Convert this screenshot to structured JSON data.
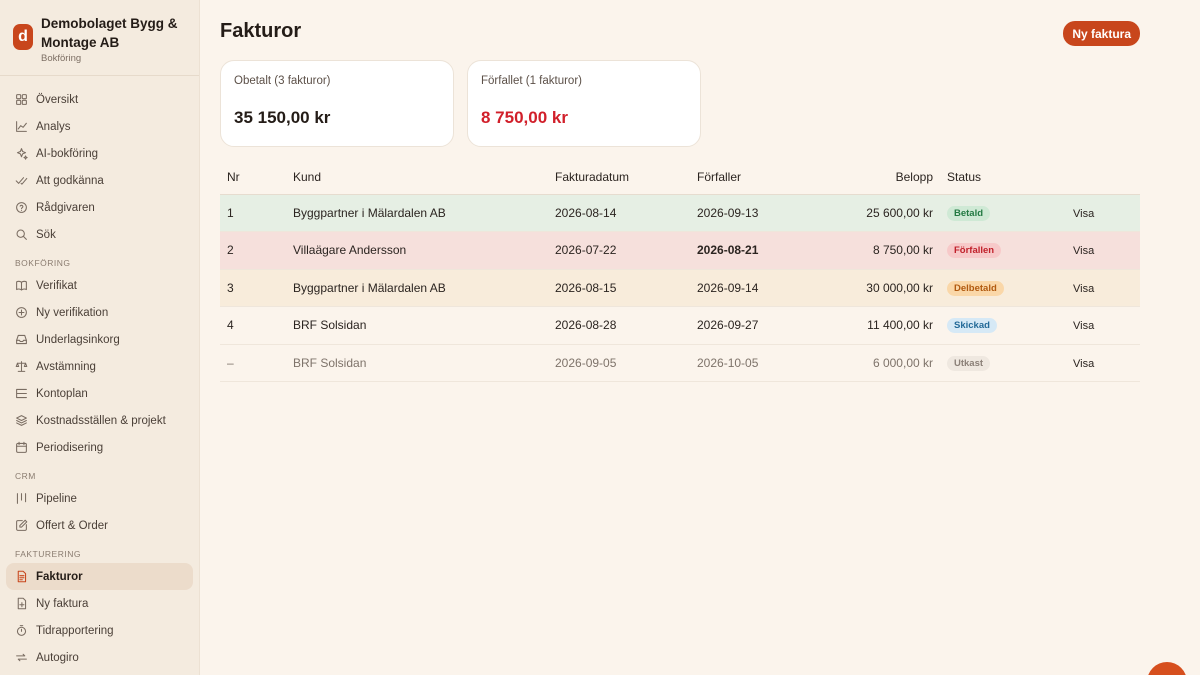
{
  "company": {
    "logo_letter": "d",
    "name": "Demobolaget Bygg & Montage AB",
    "subtitle": "Bokföring"
  },
  "sidebar": {
    "top_items": [
      {
        "label": "Översikt",
        "icon": "grid-icon"
      },
      {
        "label": "Analys",
        "icon": "chart-line-icon"
      },
      {
        "label": "AI-bokföring",
        "icon": "sparkle-icon"
      },
      {
        "label": "Att godkänna",
        "icon": "double-check-icon"
      },
      {
        "label": "Rådgivaren",
        "icon": "help-circle-icon"
      },
      {
        "label": "Sök",
        "icon": "search-icon"
      }
    ],
    "sections": [
      {
        "title": "BOKFÖRING",
        "items": [
          {
            "label": "Verifikat",
            "icon": "book-icon"
          },
          {
            "label": "Ny verifikation",
            "icon": "plus-circle-icon"
          },
          {
            "label": "Underlagsinkorg",
            "icon": "inbox-icon"
          },
          {
            "label": "Avstämning",
            "icon": "scale-icon"
          },
          {
            "label": "Kontoplan",
            "icon": "list-tree-icon"
          },
          {
            "label": "Kostnadsställen & projekt",
            "icon": "layers-icon"
          },
          {
            "label": "Periodisering",
            "icon": "calendar-icon"
          }
        ]
      },
      {
        "title": "CRM",
        "items": [
          {
            "label": "Pipeline",
            "icon": "pipeline-icon"
          },
          {
            "label": "Offert & Order",
            "icon": "edit-document-icon"
          }
        ]
      },
      {
        "title": "FAKTURERING",
        "items": [
          {
            "label": "Fakturor",
            "icon": "invoice-icon",
            "active": true
          },
          {
            "label": "Ny faktura",
            "icon": "file-plus-icon"
          },
          {
            "label": "Tidrapportering",
            "icon": "timer-icon"
          },
          {
            "label": "Autogiro",
            "icon": "repeat-icon"
          }
        ]
      }
    ]
  },
  "header": {
    "title": "Fakturor",
    "new_button": "Ny faktura"
  },
  "cards": [
    {
      "label": "Obetalt (3 fakturor)",
      "value": "35 150,00 kr",
      "highlight": false
    },
    {
      "label": "Förfallet (1 fakturor)",
      "value": "8 750,00 kr",
      "highlight": true
    }
  ],
  "table": {
    "columns": {
      "nr": "Nr",
      "customer": "Kund",
      "invoice_date": "Fakturadatum",
      "due_date": "Förfaller",
      "amount": "Belopp",
      "status": "Status"
    },
    "rows": [
      {
        "nr": "1",
        "customer": "Byggpartner i Mälardalen AB",
        "invoice_date": "2026-08-14",
        "due_date": "2026-09-13",
        "amount": "25 600,00 kr",
        "status": "Betald",
        "status_kind": "paid",
        "action": "Visa"
      },
      {
        "nr": "2",
        "customer": "Villaägare Andersson",
        "invoice_date": "2026-07-22",
        "due_date": "2026-08-21",
        "amount": "8 750,00 kr",
        "status": "Förfallen",
        "status_kind": "overdue",
        "action": "Visa"
      },
      {
        "nr": "3",
        "customer": "Byggpartner i Mälardalen AB",
        "invoice_date": "2026-08-15",
        "due_date": "2026-09-14",
        "amount": "30 000,00 kr",
        "status": "Delbetald",
        "status_kind": "partial",
        "action": "Visa"
      },
      {
        "nr": "4",
        "customer": "BRF Solsidan",
        "invoice_date": "2026-08-28",
        "due_date": "2026-09-27",
        "amount": "11 400,00 kr",
        "status": "Skickad",
        "status_kind": "sent",
        "action": "Visa"
      },
      {
        "nr": "–",
        "customer": "BRF Solsidan",
        "invoice_date": "2026-09-05",
        "due_date": "2026-10-05",
        "amount": "6 000,00 kr",
        "status": "Utkast",
        "status_kind": "draft",
        "action": "Visa"
      }
    ]
  },
  "colors": {
    "accent": "#c8461c",
    "danger": "#d11f2a",
    "background": "#fbf4ec",
    "sidebar": "#f4ebdf"
  }
}
